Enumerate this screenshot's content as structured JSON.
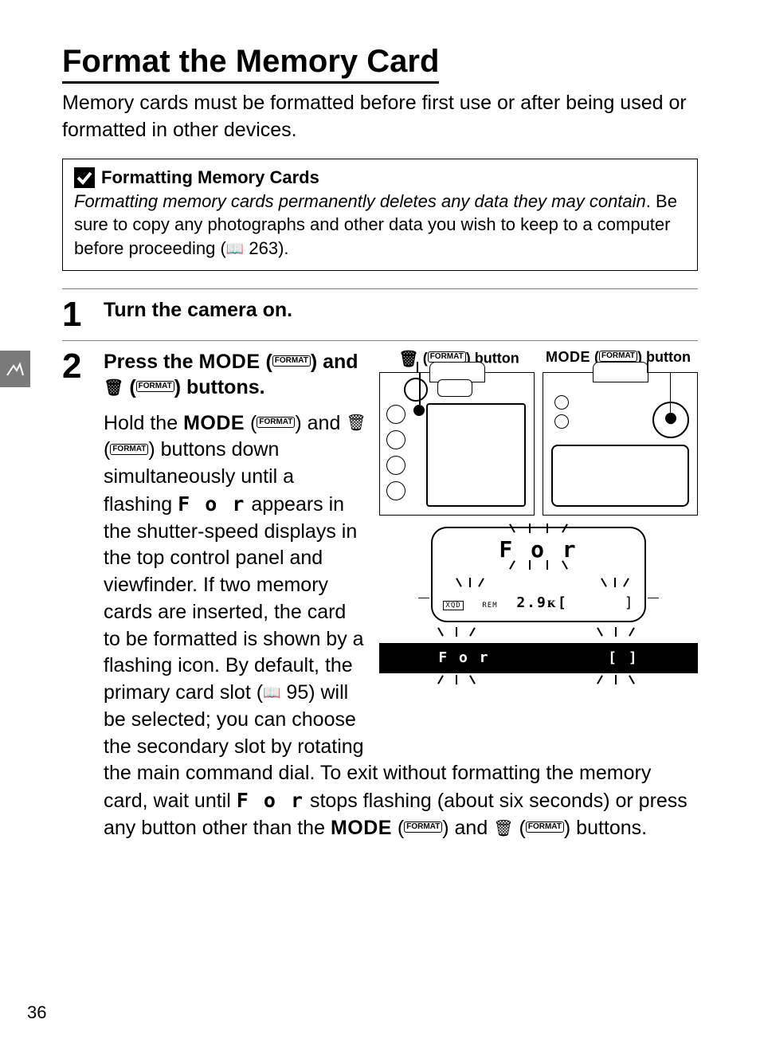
{
  "title": "Format the Memory Card",
  "intro": "Memory cards must be formatted before first use or after being used or formatted in other devices.",
  "notice": {
    "title": "Formatting Memory Cards",
    "italic_sentence": "Formatting memory cards permanently deletes any data they may contain",
    "body_after_italic": ". Be sure to copy any photographs and other data you wish to keep to a computer before proceeding (",
    "page_ref": "263",
    "body_close": ")."
  },
  "steps": {
    "s1": {
      "num": "1",
      "head": "Turn the camera on."
    },
    "s2": {
      "num": "2",
      "head_a": "Press the ",
      "head_b": " (",
      "head_c": ") and ",
      "head_d": " (",
      "head_e": ") buttons.",
      "body_a": "Hold the ",
      "body_b": " (",
      "body_c": ") and ",
      "body_d": " (",
      "body_e": ") buttons down simultaneously until a flashing ",
      "body_f": " appears in the shutter-speed displays in the top control panel and viewfinder. If two memory cards are inserted, the card to be formatted is shown by a flashing icon. By default, the primary card slot (",
      "body_g": "95",
      "body_h": ") will be selected; you can choose the secondary slot by rotating",
      "body_full_a": "the main command dial. To exit without formatting the memory card, wait until ",
      "body_full_b": " stops flashing (about six seconds) or press any button other than the ",
      "body_full_c": " (",
      "body_full_d": ") and ",
      "body_full_e": " (",
      "body_full_f": ") buttons."
    }
  },
  "labels": {
    "mode": "MODE",
    "format_pill": "FORMAT",
    "for_seg": "F o r",
    "trash_glyph": "🗑",
    "trash_button_label_a": " (",
    "trash_button_label_b": ") button",
    "mode_button_label_a": " (",
    "mode_button_label_b": ") button",
    "lcd_for": "F o r",
    "lcd_rem": "REM",
    "lcd_k": "2.9ᴋ[",
    "bar_for": "F o r",
    "bar_bracket": "[     ]"
  },
  "page_number": "36"
}
